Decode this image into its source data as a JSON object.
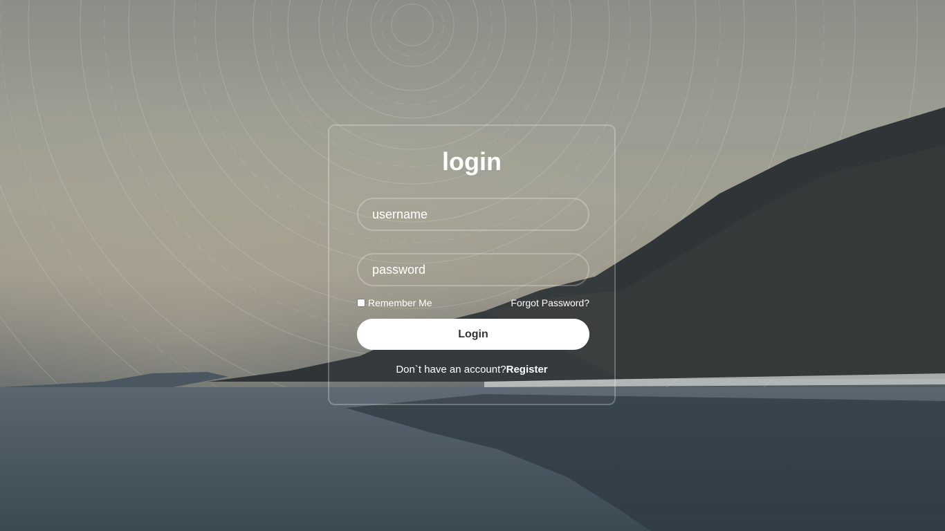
{
  "form": {
    "title": "login",
    "username_placeholder": "username",
    "password_placeholder": "password",
    "remember_label": "Remember Me",
    "forgot_label": "Forgot Password?",
    "login_label": "Login",
    "register_prompt": "Don`t have an account?",
    "register_label": "Register"
  },
  "colors": {
    "button_bg": "#ffffff",
    "button_text": "#333333",
    "text": "#ffffff"
  }
}
